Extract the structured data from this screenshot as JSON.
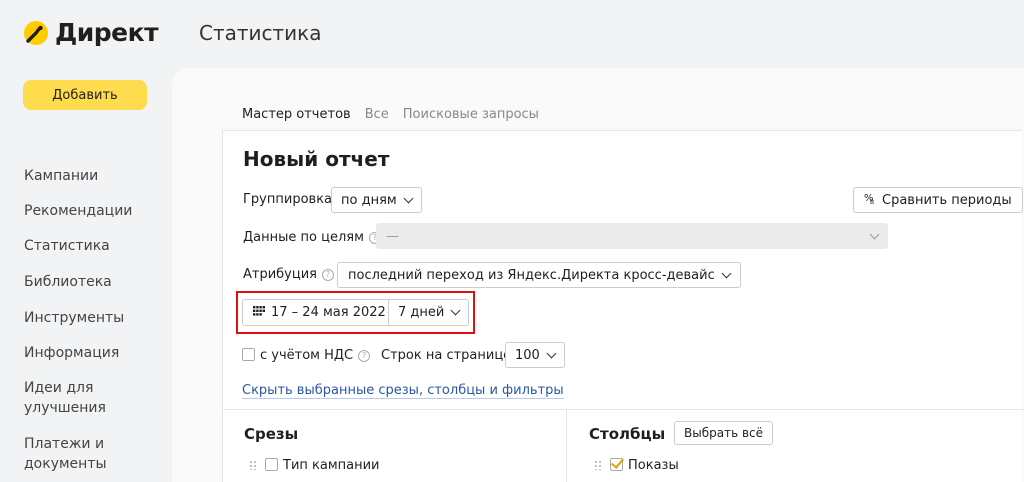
{
  "app": {
    "logo_text": "Директ",
    "page_title": "Статистика"
  },
  "sidebar": {
    "add_label": "Добавить",
    "items": [
      {
        "label": "Кампании"
      },
      {
        "label": "Рекомендации"
      },
      {
        "label": "Статистика"
      },
      {
        "label": "Библиотека"
      },
      {
        "label": "Инструменты"
      },
      {
        "label": "Информация"
      },
      {
        "label": "Идеи для\nулучшения"
      },
      {
        "label": "Платежи и\nдокументы"
      }
    ]
  },
  "tabs": [
    {
      "label": "Мастер отчетов",
      "active": true
    },
    {
      "label": "Все",
      "active": false
    },
    {
      "label": "Поисковые запросы",
      "active": false
    }
  ],
  "report": {
    "title": "Новый отчет",
    "grouping_label": "Группировка",
    "grouping_value": "по дням",
    "compare_label": "Сравнить периоды",
    "goals_label": "Данные по целям",
    "goals_value": "—",
    "attribution_label": "Атрибуция",
    "attribution_value": "последний переход из Яндекс.Директа кросс-девайс",
    "date_range": "17 – 24 мая 2022",
    "period_value": "7 дней",
    "vat_label": "с учётом НДС",
    "rows_label": "Строк на странице",
    "rows_value": "100",
    "hide_link": "Скрыть выбранные срезы, столбцы и фильтры"
  },
  "slices": {
    "title": "Срезы",
    "items": [
      {
        "label": "Тип кампании",
        "checked": false
      }
    ]
  },
  "columns": {
    "title": "Столбцы",
    "select_all": "Выбрать всё",
    "items": [
      {
        "label": "Показы",
        "checked": true
      }
    ]
  },
  "colors": {
    "accent_yellow": "#ffdb4d",
    "tab_underline": "#e0311f",
    "highlight_red": "#e01010",
    "link_blue": "#2a57a8"
  }
}
